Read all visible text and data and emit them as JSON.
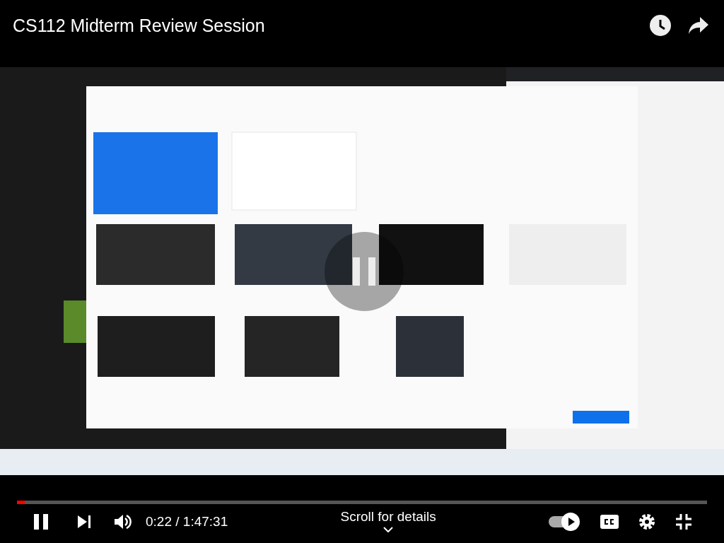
{
  "video": {
    "title": "CS112 Midterm Review Session",
    "playing": true
  },
  "progress": {
    "level": 0.011
  },
  "controls": {
    "time": "0:22 / 1:47:31",
    "scroll_hint": "Scroll for details",
    "autoplay": {
      "on": true
    }
  }
}
